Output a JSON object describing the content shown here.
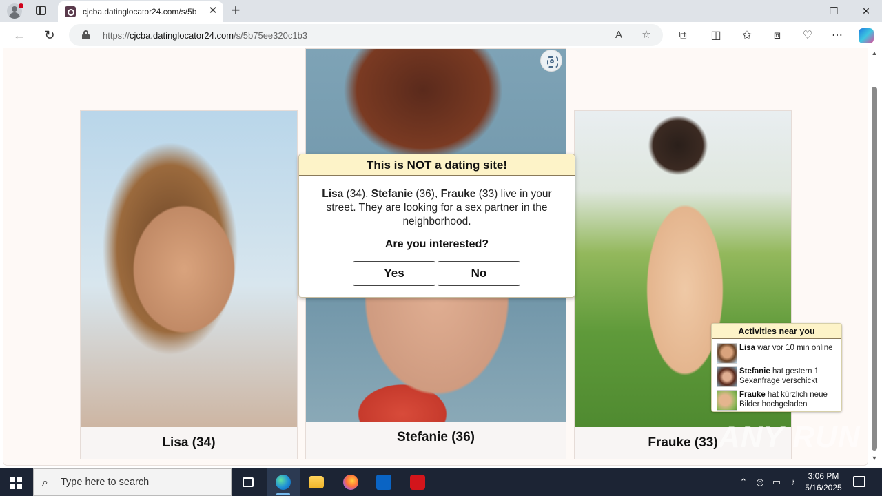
{
  "browser": {
    "tab_title": "cjcba.datinglocator24.com/s/5b",
    "tab_close": "✕",
    "new_tab": "+",
    "url_domain": "cjcba.datinglocator24.com",
    "url_prefix": "https://",
    "url_path": "/s/5b75ee320c1b3",
    "window_minimize": "—",
    "window_restore": "❐",
    "window_close": "✕",
    "icons": [
      "back-icon",
      "refresh-icon",
      "lock-icon",
      "read-aloud-icon",
      "favorite-star-icon",
      "extensions-icon",
      "split-screen-icon",
      "favorites-icon",
      "collections-icon",
      "browser-essentials-icon",
      "more-icon",
      "copilot-icon"
    ]
  },
  "cards": [
    {
      "name": "Lisa (34)"
    },
    {
      "name": "Stefanie (36)"
    },
    {
      "name": "Frauke (33)"
    }
  ],
  "modal": {
    "title": "This is NOT a dating site!",
    "names": [
      {
        "name": "Lisa",
        "age": " (34), "
      },
      {
        "name": "Stefanie",
        "age": " (36), "
      },
      {
        "name": "Frauke",
        "age": " (33)"
      }
    ],
    "message_rest": " live in your street. They are looking for a sex partner in the neighborhood.",
    "question": "Are you interested?",
    "yes_label": "Yes",
    "no_label": "No"
  },
  "activities": {
    "title": "Activities near you",
    "items": [
      {
        "name": "Lisa",
        "text": " war vor 10 min online"
      },
      {
        "name": "Stefanie",
        "text": " hat gestern 1 Sexanfrage verschickt"
      },
      {
        "name": "Frauke",
        "text": " hat kürzlich neue Bilder hochgeladen"
      }
    ]
  },
  "watermark": "ANY RUN",
  "taskbar": {
    "search_placeholder": "Type here to search",
    "time": "3:06 PM",
    "date": "5/16/2025",
    "apps": [
      "task-view-icon",
      "edge-icon",
      "file-explorer-icon",
      "firefox-icon",
      "outlook-icon",
      "acrobat-icon"
    ],
    "tray": [
      "chevron-up-icon",
      "meet-icon",
      "network-icon",
      "volume-icon",
      "notification-icon"
    ]
  },
  "colors": {
    "modal_header_bg": "#fdf3c8",
    "page_bg": "#fef9f6",
    "taskbar_bg": "#1c2434"
  }
}
